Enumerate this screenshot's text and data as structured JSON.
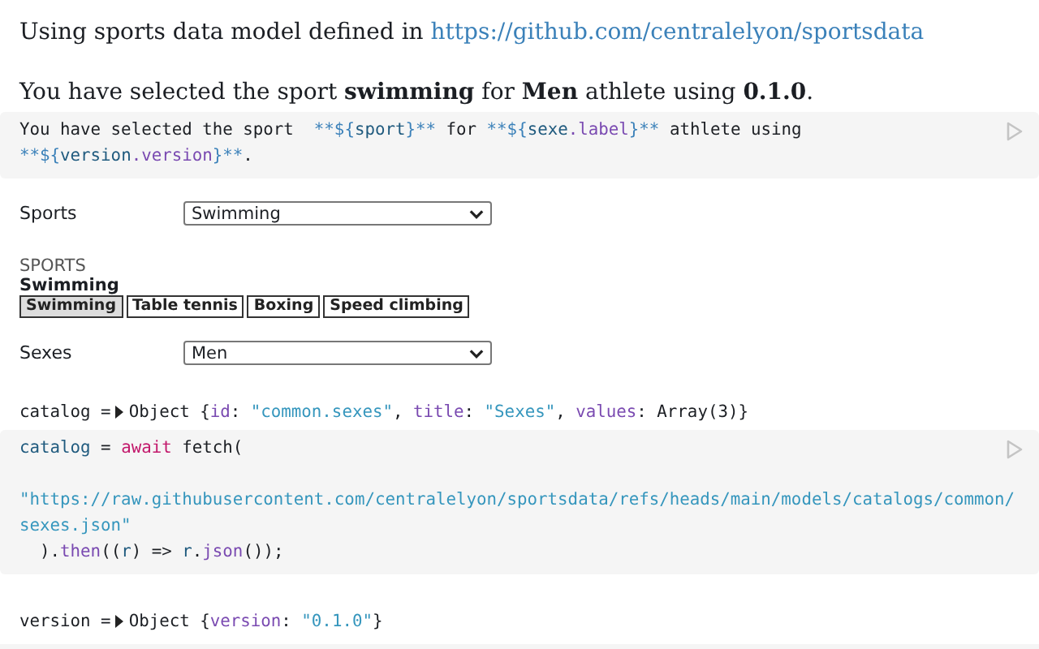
{
  "intro": {
    "text": "Using sports data model defined in",
    "link": "https://github.com/centralelyon/sportsdata"
  },
  "summary": "You have selected the sport **swimming** for **Men** athlete using **0.1.0**.",
  "blocks": [
    {
      "kind": "code",
      "lines": [
        {
          "tokens": [
            {
              "t": "You have selected the sport  ",
              "kind": "plain"
            },
            {
              "t": "**${",
              "kind": "op"
            },
            {
              "t": "sport",
              "kind": "var"
            },
            {
              "t": "}**",
              "kind": "op"
            },
            {
              "t": " for ",
              "kind": "plain"
            },
            {
              "t": "**${",
              "kind": "op"
            },
            {
              "t": "sexe",
              "kind": "var"
            },
            {
              "t": ".label",
              "kind": "prop"
            },
            {
              "t": "}**",
              "kind": "op"
            },
            {
              "t": " athlete using",
              "kind": "plain"
            }
          ]
        },
        {
          "tokens": [
            {
              "t": "**${",
              "kind": "op"
            },
            {
              "t": "version",
              "kind": "var"
            },
            {
              "t": ".version",
              "kind": "prop"
            },
            {
              "t": "}**",
              "kind": "op"
            },
            {
              "t": ".",
              "kind": "plain"
            }
          ]
        }
      ]
    },
    {
      "kind": "select",
      "label": "Sports",
      "value": "Swimming"
    },
    {
      "kind": "buttons",
      "heading": "SPORTS",
      "value": "Swimming",
      "items": [
        {
          "label": "Swimming",
          "selected": true
        },
        {
          "label": "Table tennis",
          "selected": false
        },
        {
          "label": "Boxing",
          "selected": false
        },
        {
          "label": "Speed climbing",
          "selected": false
        }
      ]
    },
    {
      "kind": "select",
      "label": "Sexes",
      "value": "Men"
    },
    {
      "kind": "output",
      "label": "catalog =",
      "tokens": [
        {
          "t": "Object {",
          "kind": "plain"
        },
        {
          "t": "id",
          "kind": "prop"
        },
        {
          "t": ": ",
          "kind": "plain"
        },
        {
          "t": "\"common.sexes\"",
          "kind": "str"
        },
        {
          "t": ", ",
          "kind": "plain"
        },
        {
          "t": "title",
          "kind": "prop"
        },
        {
          "t": ": ",
          "kind": "plain"
        },
        {
          "t": "\"Sexes\"",
          "kind": "str"
        },
        {
          "t": ", ",
          "kind": "plain"
        },
        {
          "t": "values",
          "kind": "prop"
        },
        {
          "t": ": Array(3)}",
          "kind": "plain"
        }
      ]
    },
    {
      "kind": "code",
      "lines": [
        {
          "tokens": [
            {
              "t": "catalog",
              "kind": "var"
            },
            {
              "t": " = ",
              "kind": "plain"
            },
            {
              "t": "await",
              "kind": "kw"
            },
            {
              "t": " fetch(",
              "kind": "plain"
            }
          ]
        },
        {
          "blank_before": true,
          "tokens": [
            {
              "t": "\"https://raw.githubusercontent.com/centralelyon/sportsdata/refs/heads/main/models/catalogs/common/",
              "kind": "str"
            }
          ]
        },
        {
          "tokens": [
            {
              "t": "sexes.json\"",
              "kind": "str"
            }
          ]
        },
        {
          "tokens": [
            {
              "t": "  ).",
              "kind": "plain"
            },
            {
              "t": "then",
              "kind": "prop"
            },
            {
              "t": "((",
              "kind": "plain"
            },
            {
              "t": "r",
              "kind": "var"
            },
            {
              "t": ") => ",
              "kind": "plain"
            },
            {
              "t": "r",
              "kind": "var"
            },
            {
              "t": ".",
              "kind": "plain"
            },
            {
              "t": "json",
              "kind": "prop"
            },
            {
              "t": "());",
              "kind": "plain"
            }
          ]
        }
      ]
    },
    {
      "kind": "output",
      "label": "version =",
      "tokens": [
        {
          "t": "Object {",
          "kind": "plain"
        },
        {
          "t": "version",
          "kind": "prop"
        },
        {
          "t": ": ",
          "kind": "plain"
        },
        {
          "t": "\"0.1.0\"",
          "kind": "str"
        },
        {
          "t": "}",
          "kind": "plain"
        }
      ]
    }
  ]
}
